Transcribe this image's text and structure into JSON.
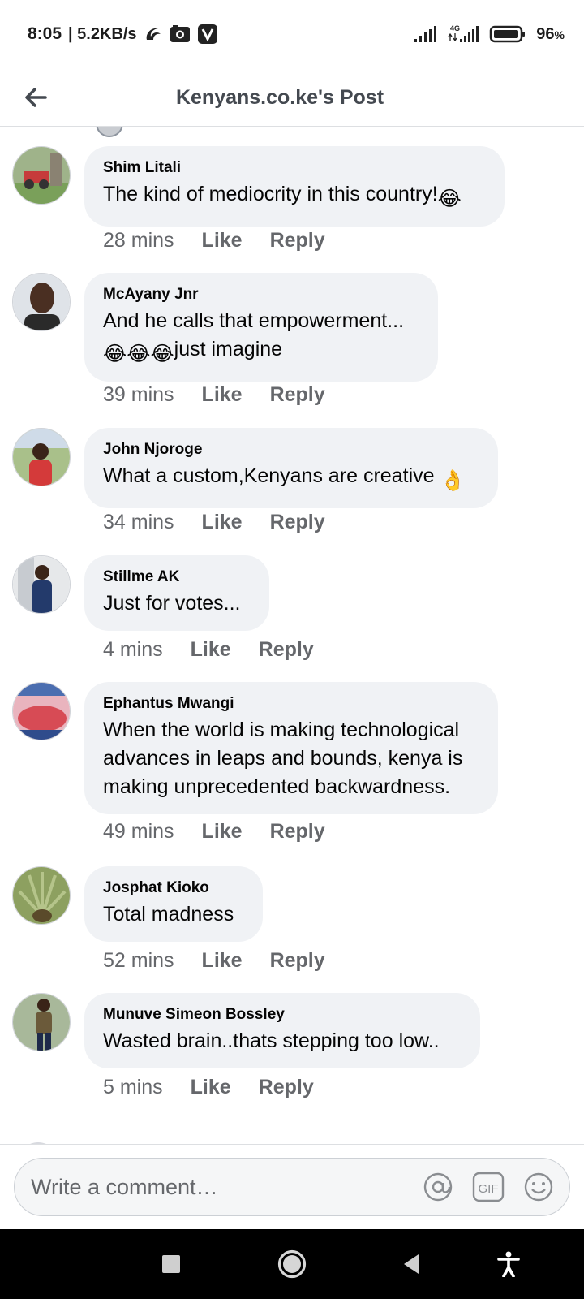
{
  "status_bar": {
    "time": "8:05",
    "speed": "| 5.2KB/s",
    "network_label": "4G",
    "battery_percent": "96",
    "battery_suffix": "%"
  },
  "header": {
    "title": "Kenyans.co.ke's Post",
    "back_icon": "arrow-left-icon"
  },
  "comments": [
    {
      "author": "Shim Litali",
      "lines": [
        "The kind of mediocrity in this country!"
      ],
      "emoji": [
        "😂"
      ],
      "time": "28 mins",
      "like": "Like",
      "reply": "Reply"
    },
    {
      "author": "McAyany Jnr",
      "lines": [
        "And he calls that empowerment...",
        "just imagine"
      ],
      "emoji": [
        "😂",
        "😂",
        "😂"
      ],
      "time": "39 mins",
      "like": "Like",
      "reply": "Reply"
    },
    {
      "author": "John Njoroge",
      "lines": [
        "What a custom,Kenyans are creative"
      ],
      "emoji": [
        "👌"
      ],
      "time": "34 mins",
      "like": "Like",
      "reply": "Reply"
    },
    {
      "author": "Stillme AK",
      "lines": [
        "Just for votes..."
      ],
      "time": "4 mins",
      "like": "Like",
      "reply": "Reply"
    },
    {
      "author": "Ephantus Mwangi",
      "lines": [
        "When the world is making technological",
        "advances in leaps and bounds, kenya is",
        "making unprecedented backwardness."
      ],
      "time": "49 mins",
      "like": "Like",
      "reply": "Reply"
    },
    {
      "author": "Josphat Kioko",
      "lines": [
        "Total madness"
      ],
      "time": "52 mins",
      "like": "Like",
      "reply": "Reply"
    },
    {
      "author": "Munuve Simeon Bossley",
      "lines": [
        "Wasted brain..thats stepping too low.."
      ],
      "time": "5 mins",
      "like": "Like",
      "reply": "Reply"
    }
  ],
  "composer": {
    "placeholder": "Write a comment…",
    "icons": [
      "at-icon",
      "gif-icon",
      "emoji-icon"
    ],
    "gif_label": "GIF"
  },
  "nav_bar": {
    "icons": [
      "recents-square-icon",
      "home-circle-icon",
      "back-triangle-icon",
      "accessibility-icon"
    ]
  },
  "colors": {
    "bubble": "#f0f2f5",
    "meta_text": "#65676b",
    "title_text": "#444950",
    "nav_bar": "#000000"
  }
}
